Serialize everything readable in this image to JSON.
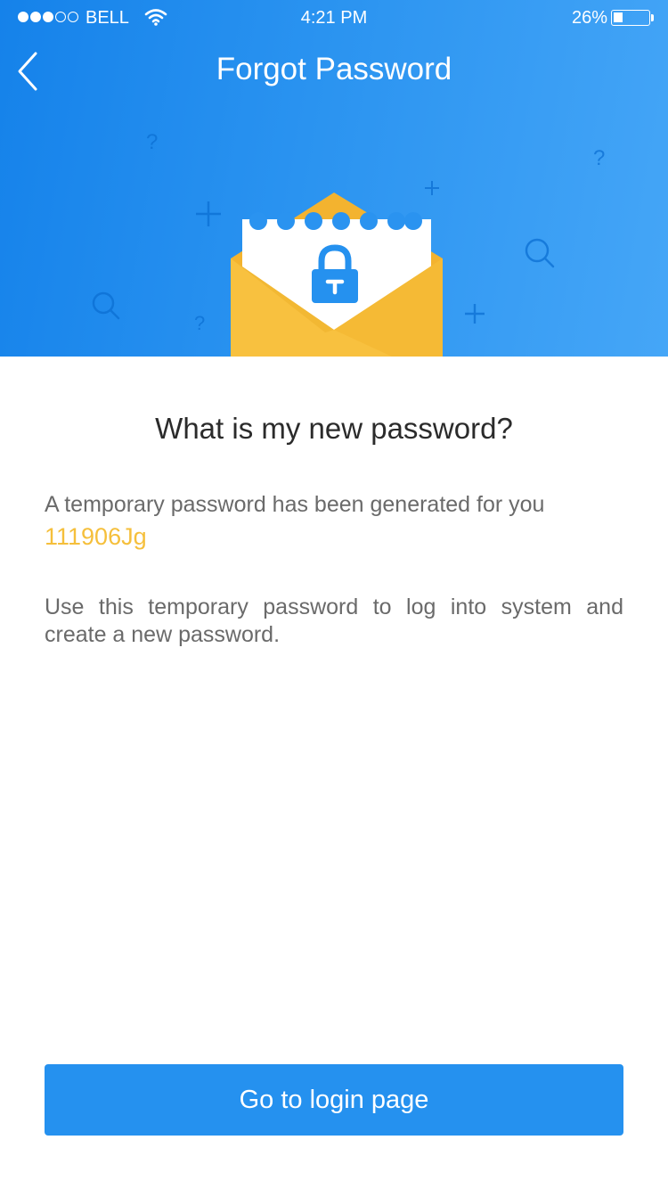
{
  "status_bar": {
    "carrier": "BELL",
    "time": "4:21 PM",
    "battery_percent": "26%",
    "battery_level": 0.26,
    "signal_bars_filled": 3,
    "signal_bars_total": 5
  },
  "nav": {
    "title": "Forgot Password",
    "back_icon": "chevron-left-icon"
  },
  "illustration": {
    "icons": [
      "envelope-icon",
      "lock-icon",
      "question-mark-icon",
      "plus-icon",
      "magnifier-icon"
    ]
  },
  "content": {
    "heading": "What is my new password?",
    "generated_text": "A temporary password has been generated for you",
    "temporary_password": "111906Jg",
    "instruction_text": "Use this temporary password to log into system and create a new password."
  },
  "actions": {
    "login_button": "Go to login page"
  },
  "colors": {
    "header_gradient_start": "#1582ea",
    "header_gradient_end": "#45a6f7",
    "accent": "#f5bf3b",
    "button": "#2591ef",
    "envelope": "#f8c13f"
  }
}
